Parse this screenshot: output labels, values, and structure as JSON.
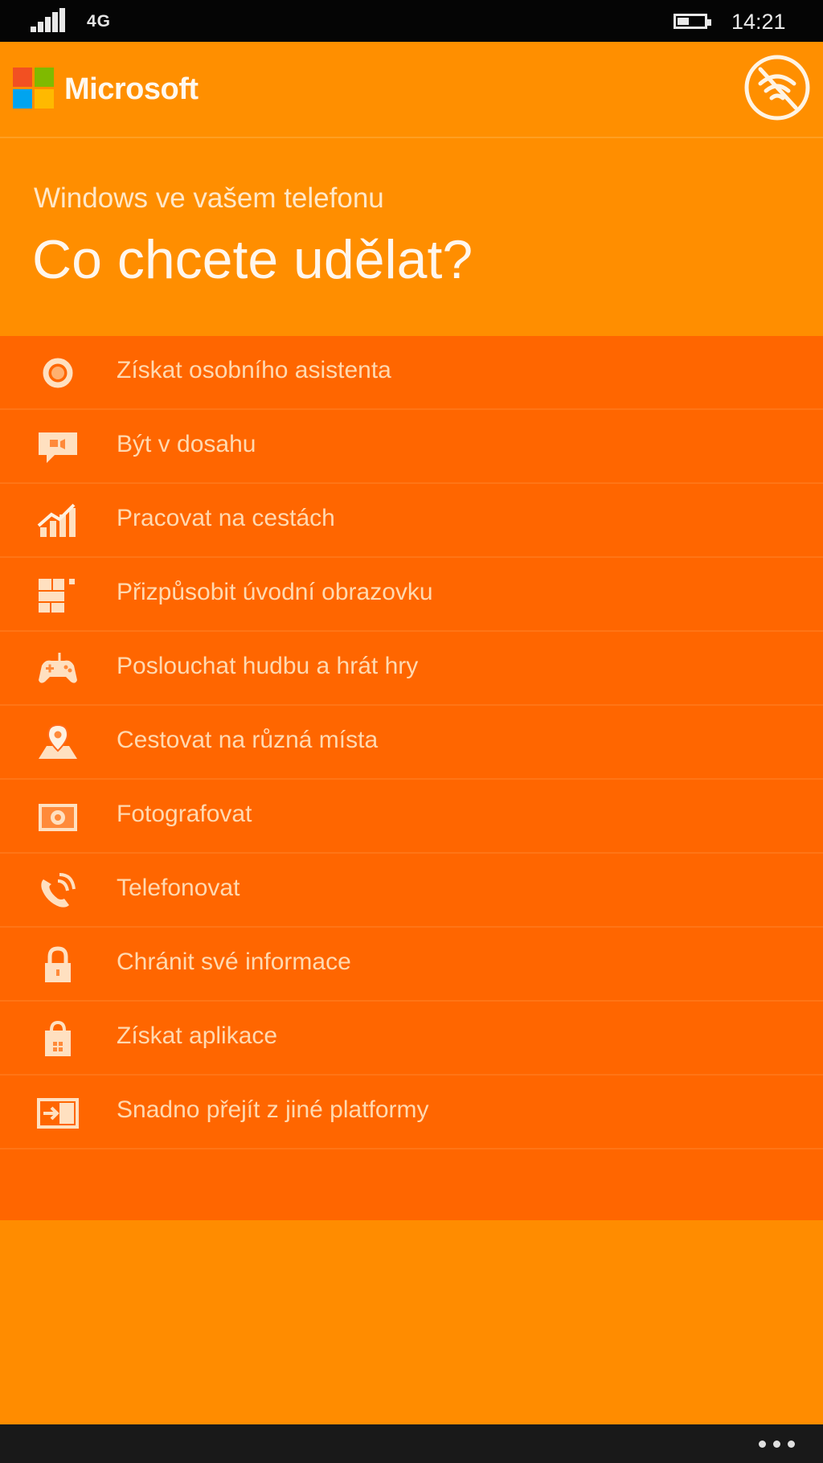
{
  "status_bar": {
    "network": "4G",
    "time": "14:21",
    "battery_level": 0.45,
    "signal_icon": "signal-bars-icon",
    "battery_icon": "battery-icon"
  },
  "app_bar": {
    "brand": "Microsoft",
    "logo_colors": [
      "#f25022",
      "#7fba00",
      "#00a4ef",
      "#ffb900"
    ],
    "offline_icon": "no-wifi-icon"
  },
  "header": {
    "subtitle": "Windows ve vašem telefonu",
    "title": "Co chcete udělat?"
  },
  "menu": {
    "items": [
      {
        "label": "Získat osobního asistenta",
        "icon": "cortana-icon"
      },
      {
        "label": "Být v dosahu",
        "icon": "message-icon"
      },
      {
        "label": "Pracovat na cestách",
        "icon": "office-chart-icon"
      },
      {
        "label": "Přizpůsobit úvodní obrazovku",
        "icon": "start-tiles-icon"
      },
      {
        "label": "Poslouchat hudbu a hrát hry",
        "icon": "gamepad-icon"
      },
      {
        "label": "Cestovat na různá místa",
        "icon": "map-pin-icon"
      },
      {
        "label": "Fotografovat",
        "icon": "camera-icon"
      },
      {
        "label": "Telefonovat",
        "icon": "phone-icon"
      },
      {
        "label": "Chránit své informace",
        "icon": "lock-icon"
      },
      {
        "label": "Získat aplikace",
        "icon": "store-bag-icon"
      },
      {
        "label": "Snadno přejít z jiné platformy",
        "icon": "switch-platform-icon"
      }
    ]
  },
  "colors": {
    "primary_orange": "#ff8c00",
    "menu_orange": "#ff6600",
    "text_light": "#ffd9b0"
  },
  "nav_bar": {
    "more_icon": "more-dots-icon"
  }
}
